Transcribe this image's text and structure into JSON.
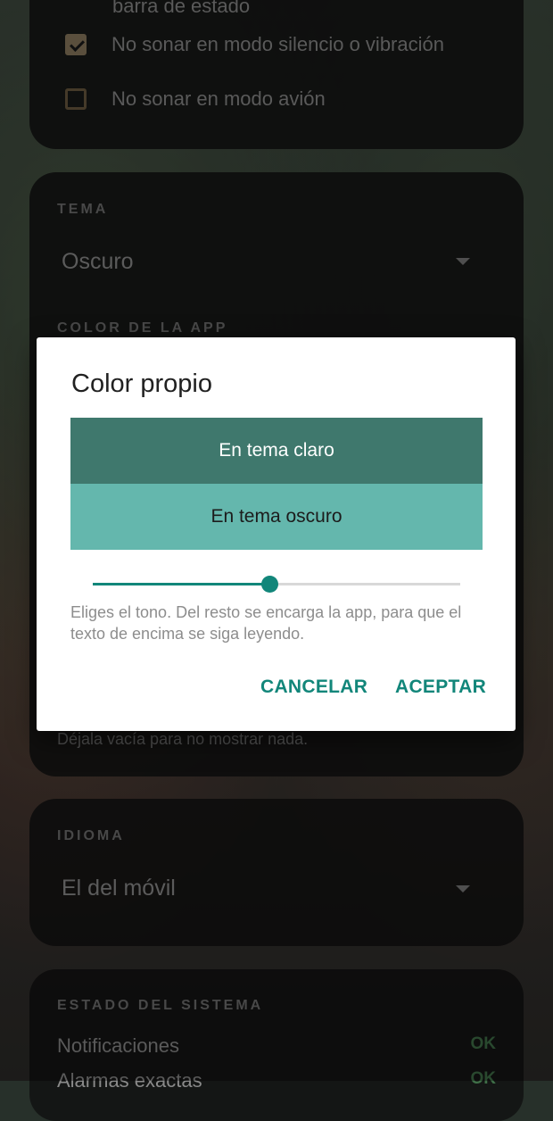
{
  "notifications_card": {
    "partial_text": "barra de estado",
    "options": [
      {
        "label": "No sonar en modo silencio o vibración",
        "checked": true
      },
      {
        "label": "No sonar en modo avión",
        "checked": false
      }
    ]
  },
  "appearance_card": {
    "theme_label": "TEMA",
    "theme_value": "Oscuro",
    "color_label": "COLOR DE LA APP",
    "hint_text": "Déjala vacía para no mostrar nada."
  },
  "language_card": {
    "label": "IDIOMA",
    "value": "El del móvil"
  },
  "system_card": {
    "label": "ESTADO DEL SISTEMA",
    "rows": [
      {
        "name": "Notificaciones",
        "status": "OK"
      },
      {
        "name": "Alarmas exactas",
        "status": "OK"
      }
    ]
  },
  "dialog": {
    "title": "Color propio",
    "light_label": "En tema claro",
    "dark_label": "En tema oscuro",
    "slider_value": 0.48,
    "help_text": "Eliges el tono. Del resto se encarga la app, para que el texto de encima se siga leyendo.",
    "cancel_label": "CANCELAR",
    "accept_label": "ACEPTAR"
  },
  "colors": {
    "accent": "#12867a",
    "light_swatch": "#3f786d",
    "dark_swatch": "#64b7ad"
  }
}
